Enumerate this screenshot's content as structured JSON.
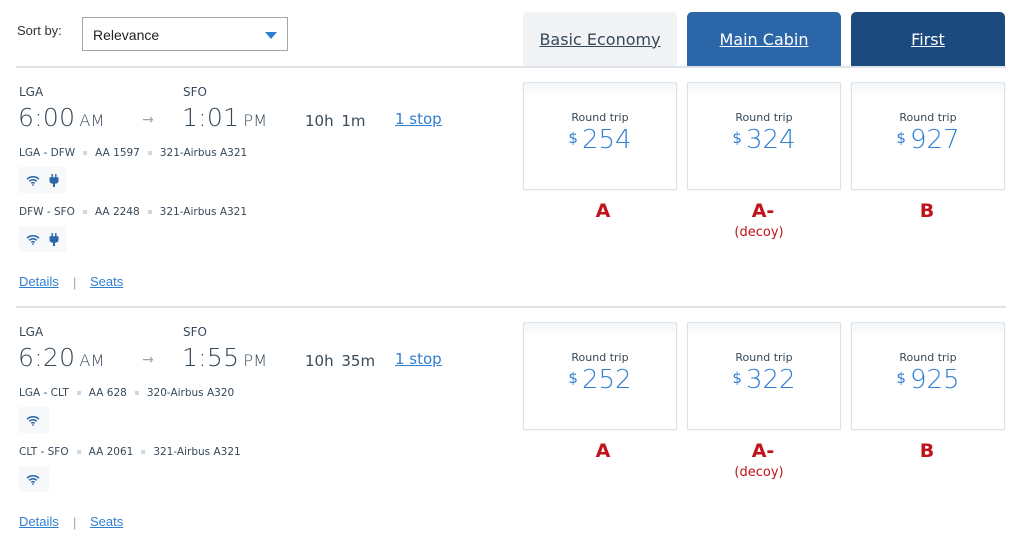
{
  "sort": {
    "label": "Sort by:",
    "selected": "Relevance"
  },
  "cabin_tabs": [
    {
      "label": "Basic Economy",
      "color": "#f2f3f5"
    },
    {
      "label": "Main Cabin",
      "color": "#2a66a8"
    },
    {
      "label": "First",
      "color": "#1b4a7e"
    }
  ],
  "flights": [
    {
      "origin": "LGA",
      "destination": "SFO",
      "depart_time": "6:00",
      "depart_ampm": "AM",
      "arrive_time": "1:01",
      "arrive_ampm": "PM",
      "arrow": "→",
      "duration": "10h 1m",
      "stops": "1 stop",
      "segments": [
        {
          "route": "LGA - DFW",
          "flight": "AA 1597",
          "aircraft": "321-Airbus A321",
          "amenities": [
            "wifi-icon",
            "power-outlet-icon"
          ]
        },
        {
          "route": "DFW - SFO",
          "flight": "AA 2248",
          "aircraft": "321-Airbus A321",
          "amenities": [
            "wifi-icon",
            "power-outlet-icon"
          ]
        }
      ],
      "links": {
        "details": "Details",
        "separator": "|",
        "seats": "Seats"
      },
      "fares": [
        {
          "label": "Round trip",
          "currency": "$",
          "amount": "254",
          "grade": "A",
          "note": ""
        },
        {
          "label": "Round trip",
          "currency": "$",
          "amount": "324",
          "grade": "A-",
          "note": "(decoy)"
        },
        {
          "label": "Round trip",
          "currency": "$",
          "amount": "927",
          "grade": "B",
          "note": ""
        }
      ]
    },
    {
      "origin": "LGA",
      "destination": "SFO",
      "depart_time": "6:20",
      "depart_ampm": "AM",
      "arrive_time": "1:55",
      "arrive_ampm": "PM",
      "arrow": "→",
      "duration": "10h 35m",
      "stops": "1 stop",
      "segments": [
        {
          "route": "LGA - CLT",
          "flight": "AA 628",
          "aircraft": "320-Airbus A320",
          "amenities": [
            "wifi-icon"
          ]
        },
        {
          "route": "CLT - SFO",
          "flight": "AA 2061",
          "aircraft": "321-Airbus A321",
          "amenities": [
            "wifi-icon"
          ]
        }
      ],
      "links": {
        "details": "Details",
        "separator": "|",
        "seats": "Seats"
      },
      "fares": [
        {
          "label": "Round trip",
          "currency": "$",
          "amount": "252",
          "grade": "A",
          "note": ""
        },
        {
          "label": "Round trip",
          "currency": "$",
          "amount": "322",
          "grade": "A-",
          "note": "(decoy)"
        },
        {
          "label": "Round trip",
          "currency": "$",
          "amount": "925",
          "grade": "B",
          "note": ""
        }
      ]
    }
  ],
  "colors": {
    "link": "#2f7fd1",
    "price": "#2f7fd1",
    "grade": "#c0131b",
    "icon": "#2a66a8"
  }
}
